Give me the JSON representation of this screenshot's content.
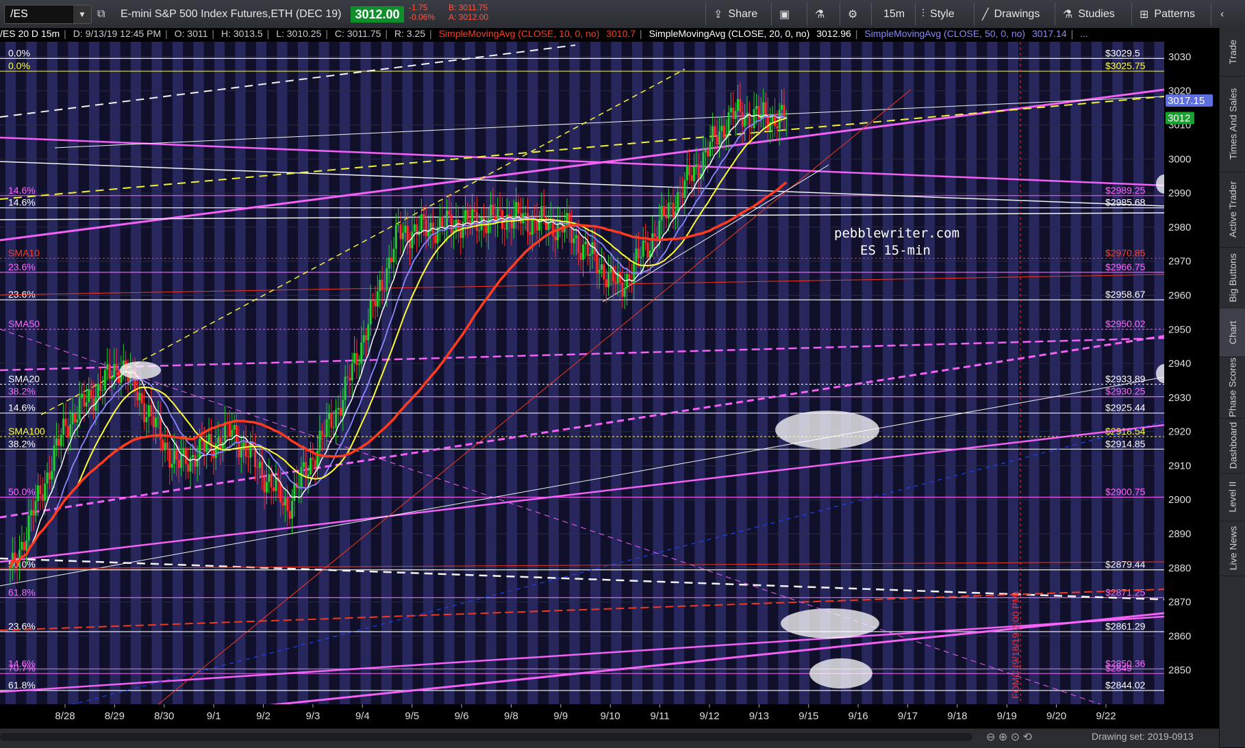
{
  "toolbar": {
    "symbol": "/ES",
    "instrument": "E-mini S&P 500 Index Futures,ETH (DEC 19)",
    "last_price": "3012.00",
    "change": "-1.75",
    "change_pct": "-0.06%",
    "bid": "B: 3011.75",
    "ask": "A: 3012.00",
    "share_label": "Share",
    "timeframe_label": "15m",
    "style_label": "Style",
    "drawings_label": "Drawings",
    "studies_label": "Studies",
    "patterns_label": "Patterns"
  },
  "study_bar": {
    "chart_id": "/ES 20 D 15m",
    "date": "D: 9/13/19 12:45 PM",
    "open": "O: 3011",
    "high": "H: 3013.5",
    "low": "L: 3010.25",
    "close": "C: 3011.75",
    "range": "R: 3.25",
    "sma10_label": "SimpleMovingAvg (CLOSE, 10, 0, no)",
    "sma10_value": "3010.7",
    "sma20_label": "SimpleMovingAvg (CLOSE, 20, 0, no)",
    "sma20_value": "3012.96",
    "sma50_label": "SimpleMovingAvg (CLOSE, 50, 0, no)",
    "sma50_value": "3017.14",
    "more": "..."
  },
  "right_panel": [
    "Trade",
    "Times And Sales",
    "Active Trader",
    "Big Buttons",
    "Chart",
    "Phase Scores",
    "Dashboard",
    "Level II",
    "Live News"
  ],
  "watermark": [
    "pebblewriter.com",
    "ES 15-min"
  ],
  "vertical_note": "FOMC (9/18/19 2:00 PM)",
  "bottom": {
    "drawing_set": "Drawing set: 2019-0913"
  },
  "colors": {
    "pink": "#ff66ff",
    "yellow": "#ffff33",
    "red": "#ff3b1f",
    "white": "#ffffff",
    "blue": "#8888ff",
    "bg_dark": "#10102a",
    "bg_band": "#2b2b66"
  },
  "chart_data": {
    "type": "candlestick",
    "ylim": [
      2840,
      3034
    ],
    "y_ticks": [
      3030,
      3020,
      3010,
      3000,
      2990,
      2980,
      2970,
      2960,
      2950,
      2940,
      2930,
      2920,
      2910,
      2900,
      2890,
      2880,
      2870,
      2860,
      2850
    ],
    "x_labels": [
      "8/28",
      "8/29",
      "8/30",
      "9/1",
      "9/2",
      "9/3",
      "9/4",
      "9/5",
      "9/6",
      "9/8",
      "9/9",
      "9/10",
      "9/11",
      "9/12",
      "9/13",
      "9/15",
      "9/16",
      "9/17",
      "9/18",
      "9/19",
      "9/20",
      "9/22"
    ],
    "price_tags": [
      {
        "label": "3017.15",
        "value": 3017.15,
        "color": "#5f6fe0"
      },
      {
        "label": "3012",
        "value": 3012,
        "color": "#18a02e"
      }
    ],
    "levels": [
      {
        "value": 3029.5,
        "left": "0.0%",
        "right": "$3029.5",
        "color": "#ffffff"
      },
      {
        "value": 3025.75,
        "left": "0.0%",
        "right": "$3025.75",
        "color": "#ffff33"
      },
      {
        "value": 2989.25,
        "left": "14.6%",
        "right": "$2989.25",
        "color": "#ff66ff"
      },
      {
        "value": 2985.68,
        "left": "14.6%",
        "right": "$2985.68",
        "color": "#ffffff"
      },
      {
        "value": 2970.85,
        "left": "SMA10",
        "right": "$2970.85",
        "color": "#ff3b1f"
      },
      {
        "value": 2966.75,
        "left": "23.6%",
        "right": "$2966.75",
        "color": "#ff66ff"
      },
      {
        "value": 2958.67,
        "left": "23.6%",
        "right": "$2958.67",
        "color": "#ffffff"
      },
      {
        "value": 2950.02,
        "left": "SMA50",
        "right": "$2950.02",
        "color": "#ff66ff"
      },
      {
        "value": 2933.89,
        "left": "SMA20",
        "right": "$2933.89",
        "color": "#ffffff"
      },
      {
        "value": 2930.25,
        "left": "38.2%",
        "right": "$2930.25",
        "color": "#ff66ff"
      },
      {
        "value": 2925.44,
        "left": "14.6%",
        "right": "$2925.44",
        "color": "#ffffff"
      },
      {
        "value": 2918.54,
        "left": "SMA100",
        "right": "$2918.54",
        "color": "#ffff33"
      },
      {
        "value": 2914.85,
        "left": "38.2%",
        "right": "$2914.85",
        "color": "#ffffff"
      },
      {
        "value": 2900.75,
        "left": "50.0%",
        "right": "$2900.75",
        "color": "#ff66ff"
      },
      {
        "value": 2879.44,
        "left": "50.0%",
        "right": "$2879.44",
        "color": "#ffffff"
      },
      {
        "value": 2871.25,
        "left": "61.8%",
        "right": "$2871.25",
        "color": "#ff66ff"
      },
      {
        "value": 2861.29,
        "left": "23.6%",
        "right": "$2861.29",
        "color": "#ffffff"
      },
      {
        "value": 2850.36,
        "left": "14.6%",
        "right": "$2850.36",
        "color": "#ff66ff"
      },
      {
        "value": 2849,
        "left": "70.7%",
        "right": "$2849",
        "color": "#ff66ff"
      },
      {
        "value": 2844.02,
        "left": "61.8%",
        "right": "$2844.02",
        "color": "#ffffff"
      }
    ],
    "close_path_by_day": [
      {
        "day": "8/28",
        "close": 2878
      },
      {
        "day": "8/29",
        "close": 2922
      },
      {
        "day": "8/30",
        "close": 2940
      },
      {
        "day": "9/1",
        "close": 2910
      },
      {
        "day": "9/2",
        "close": 2920
      },
      {
        "day": "9/3",
        "close": 2898
      },
      {
        "day": "9/4",
        "close": 2930
      },
      {
        "day": "9/5",
        "close": 2978
      },
      {
        "day": "9/6",
        "close": 2981
      },
      {
        "day": "9/8",
        "close": 2983
      },
      {
        "day": "9/9",
        "close": 2980
      },
      {
        "day": "9/10",
        "close": 2962
      },
      {
        "day": "9/11",
        "close": 2988
      },
      {
        "day": "9/12",
        "close": 3013
      },
      {
        "day": "9/13",
        "close": 3012
      }
    ],
    "series": [
      {
        "name": "SimpleMovingAvg (CLOSE, 10, 0, no)",
        "color": "#ffffff"
      },
      {
        "name": "SimpleMovingAvg (CLOSE, 20, 0, no)",
        "color": "#ffff33"
      },
      {
        "name": "SimpleMovingAvg (CLOSE, 50, 0, no)",
        "color": "#8888ff"
      }
    ]
  }
}
